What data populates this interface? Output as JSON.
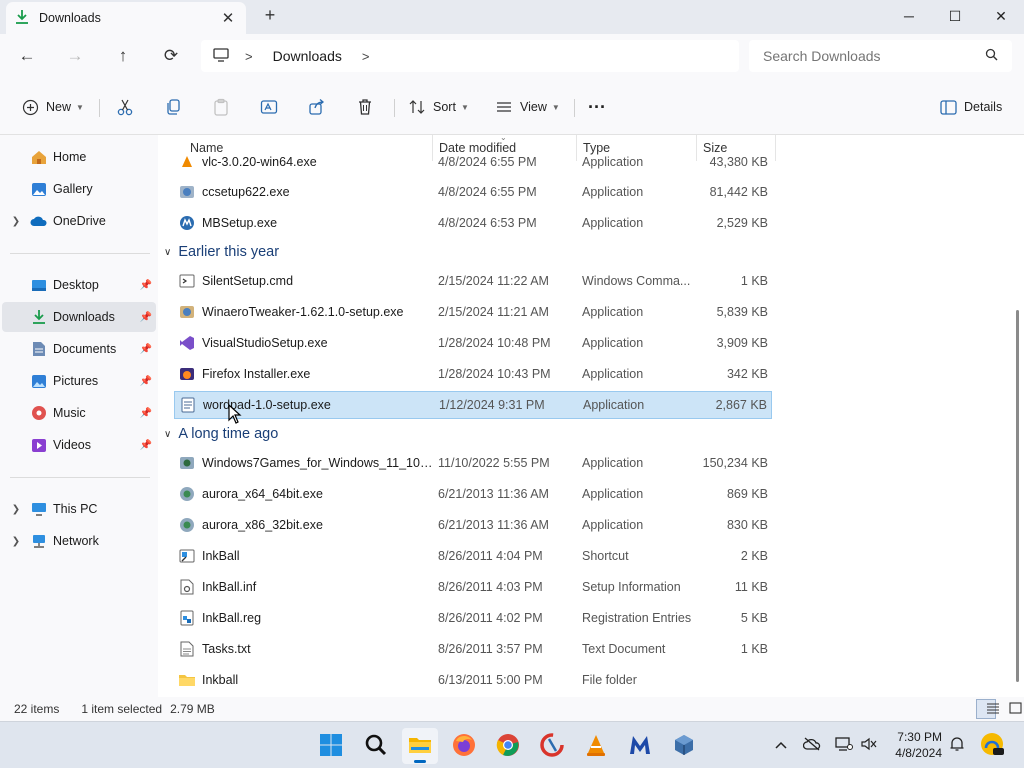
{
  "window": {
    "tab_title": "Downloads",
    "tab_close": "✕",
    "new_tab": "+",
    "controls": {
      "minimize": "─",
      "maximize": "☐",
      "close": "✕"
    }
  },
  "nav": {
    "back": "←",
    "forward": "→",
    "up": "↑",
    "refresh": "⟳"
  },
  "address": {
    "separator": ">",
    "crumb": "Downloads",
    "trailing": ">"
  },
  "search": {
    "placeholder": "Search Downloads"
  },
  "commands": {
    "new": "New",
    "sort": "Sort",
    "view": "View",
    "more": "···",
    "details": "Details"
  },
  "sidebar": {
    "items": [
      {
        "label": "Home"
      },
      {
        "label": "Gallery"
      },
      {
        "label": "OneDrive"
      },
      {
        "label": "Desktop"
      },
      {
        "label": "Downloads"
      },
      {
        "label": "Documents"
      },
      {
        "label": "Pictures"
      },
      {
        "label": "Music"
      },
      {
        "label": "Videos"
      },
      {
        "label": "This PC"
      },
      {
        "label": "Network"
      }
    ]
  },
  "columns": {
    "name": "Name",
    "date": "Date modified",
    "type": "Type",
    "size": "Size"
  },
  "groups": {
    "earlier": "Earlier this year",
    "longago": "A long time ago"
  },
  "files": [
    {
      "name": "vlc-3.0.20-win64.exe",
      "date": "4/8/2024 6:55 PM",
      "type": "Application",
      "size": "43,380 KB"
    },
    {
      "name": "ccsetup622.exe",
      "date": "4/8/2024 6:55 PM",
      "type": "Application",
      "size": "81,442 KB"
    },
    {
      "name": "MBSetup.exe",
      "date": "4/8/2024 6:53 PM",
      "type": "Application",
      "size": "2,529 KB"
    },
    {
      "name": "SilentSetup.cmd",
      "date": "2/15/2024 11:22 AM",
      "type": "Windows Comma...",
      "size": "1 KB"
    },
    {
      "name": "WinaeroTweaker-1.62.1.0-setup.exe",
      "date": "2/15/2024 11:21 AM",
      "type": "Application",
      "size": "5,839 KB"
    },
    {
      "name": "VisualStudioSetup.exe",
      "date": "1/28/2024 10:48 PM",
      "type": "Application",
      "size": "3,909 KB"
    },
    {
      "name": "Firefox Installer.exe",
      "date": "1/28/2024 10:43 PM",
      "type": "Application",
      "size": "342 KB"
    },
    {
      "name": "wordpad-1.0-setup.exe",
      "date": "1/12/2024 9:31 PM",
      "type": "Application",
      "size": "2,867 KB"
    },
    {
      "name": "Windows7Games_for_Windows_11_10_8....",
      "date": "11/10/2022 5:55 PM",
      "type": "Application",
      "size": "150,234 KB"
    },
    {
      "name": "aurora_x64_64bit.exe",
      "date": "6/21/2013 11:36 AM",
      "type": "Application",
      "size": "869 KB"
    },
    {
      "name": "aurora_x86_32bit.exe",
      "date": "6/21/2013 11:36 AM",
      "type": "Application",
      "size": "830 KB"
    },
    {
      "name": "InkBall",
      "date": "8/26/2011 4:04 PM",
      "type": "Shortcut",
      "size": "2 KB"
    },
    {
      "name": "InkBall.inf",
      "date": "8/26/2011 4:03 PM",
      "type": "Setup Information",
      "size": "11 KB"
    },
    {
      "name": "InkBall.reg",
      "date": "8/26/2011 4:02 PM",
      "type": "Registration Entries",
      "size": "5 KB"
    },
    {
      "name": "Tasks.txt",
      "date": "8/26/2011 3:57 PM",
      "type": "Text Document",
      "size": "1 KB"
    },
    {
      "name": "Inkball",
      "date": "6/13/2011 5:00 PM",
      "type": "File folder",
      "size": ""
    }
  ],
  "status": {
    "count": "22 items",
    "selection": "1 item selected",
    "selsize": "2.79 MB"
  },
  "clock": {
    "time": "7:30 PM",
    "date": "4/8/2024"
  },
  "colors": {
    "accent": "#0067c0",
    "selection": "#cce4f7",
    "group": "#1a3f77"
  }
}
